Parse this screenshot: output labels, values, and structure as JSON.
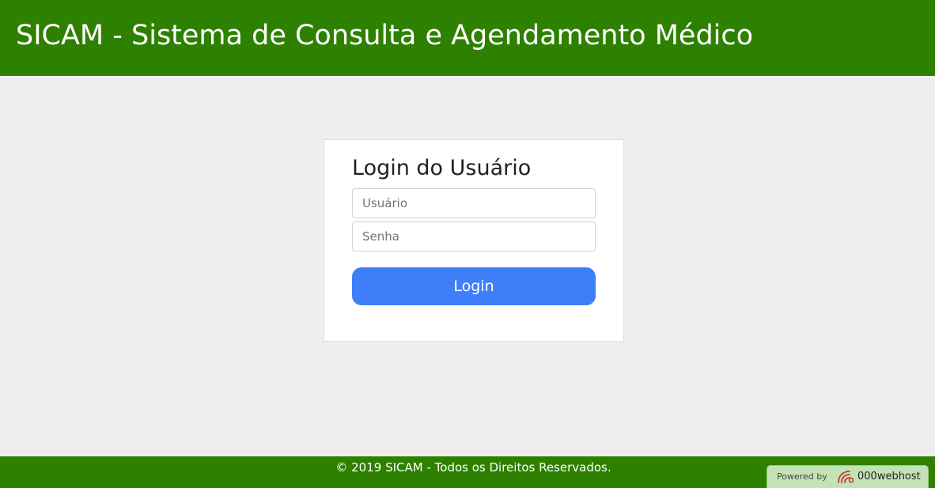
{
  "header": {
    "title": "SICAM - Sistema de Consulta e Agendamento Médico"
  },
  "login": {
    "heading": "Login do Usuário",
    "username": {
      "placeholder": "Usuário",
      "value": ""
    },
    "password": {
      "placeholder": "Senha",
      "value": ""
    },
    "button_label": "Login"
  },
  "footer": {
    "copyright": "© 2019 SICAM - Todos os Direitos Reservados."
  },
  "badge": {
    "powered_by": "Powered by",
    "brand": "000webhost",
    "icon": "000webhost-logo-icon"
  },
  "colors": {
    "header_bg": "#2e8000",
    "page_bg": "#eeeeee",
    "button_bg": "#3f7ef9",
    "badge_bg": "#c3e3b6",
    "logo_red": "#c62828"
  }
}
